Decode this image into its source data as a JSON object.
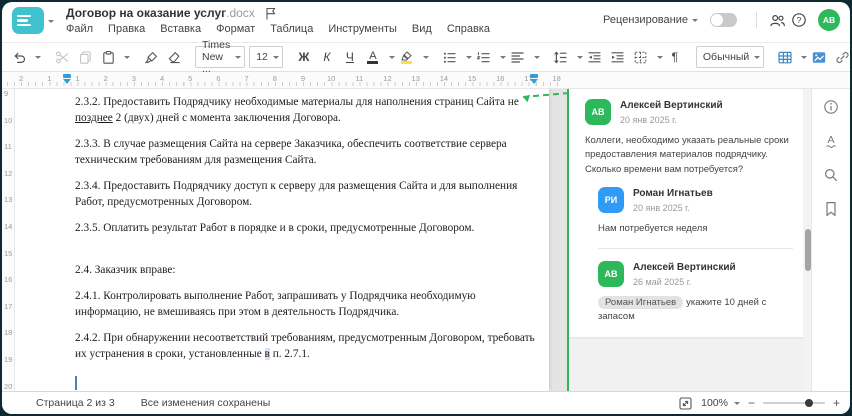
{
  "window": {
    "title": "Договор на оказание услуг",
    "title_ext": ".docx",
    "outer_bg": "#0d2a30",
    "logo_color": "#3fc2cd"
  },
  "menu": [
    "Файл",
    "Правка",
    "Вставка",
    "Формат",
    "Таблица",
    "Инструменты",
    "Вид",
    "Справка"
  ],
  "header": {
    "review_label": "Рецензирование",
    "review_toggle_on": false,
    "avatar_initials": "АВ",
    "avatar_color": "#2eb85c",
    "icons": [
      "dropdown-caret",
      "review-toggle",
      "collaboration-icon",
      "help-icon",
      "avatar"
    ]
  },
  "toolbar": {
    "font_name": "Times New ...",
    "font_size": "12",
    "bold_label": "Ж",
    "italic_label": "К",
    "underline_label": "Ч",
    "font_color_letter": "А",
    "highlight_color": "#fce143",
    "pilcrow": "¶",
    "style_name": "Обычный",
    "icons": [
      "undo-icon",
      "cut-icon",
      "copy-icon",
      "paste-icon",
      "format-painter-icon",
      "eraser-icon",
      "bullet-list-icon",
      "numbered-list-icon",
      "align-icon",
      "line-spacing-icon",
      "outdent-icon",
      "indent-icon",
      "borders-icon",
      "table-icon",
      "image-icon",
      "link-icon",
      "comment-icon",
      "more-icon"
    ],
    "accent_blue": "#3f88c5"
  },
  "ruler": {
    "h_numbers": [
      "2",
      "1",
      "1",
      "2",
      "3",
      "4",
      "5",
      "6",
      "7",
      "8",
      "9",
      "10",
      "11",
      "12",
      "13",
      "14",
      "15",
      "16",
      "17",
      "18"
    ],
    "v_numbers": [
      "9",
      "10",
      "11",
      "12",
      "13",
      "14",
      "15",
      "16",
      "17",
      "18",
      "19",
      "20"
    ],
    "marker_color": "#2f9fd8"
  },
  "document": {
    "p_232_pre": "2.3.2. Предоставить Подрядчику необходимые материалы для наполнения страниц Сайта не ",
    "p_232_underlined": "позднее",
    "p_232_post": " 2 (двух) дней с момента заключения Договора.",
    "p_233": "2.3.3. В случае размещения Сайта на сервере Заказчика, обеспечить соответствие сервера техническим требованиям для размещения Сайта.",
    "p_234": "2.3.4. Предоставить Подрядчику доступ к серверу для размещения Сайта и для выполнения Работ, предусмотренных Договором.",
    "p_235": "2.3.5. Оплатить результат Работ в порядке и в сроки, предусмотренные Договором.",
    "p_24": "2.4. Заказчик вправе:",
    "p_241": "2.4.1. Контролировать выполнение Работ, запрашивать у Подрядчика необходимую информацию, не вмешиваясь при этом в деятельность Подрядчика.",
    "p_242_pre": "2.4.2. При обнаружении несоответствий требованиям, предусмотренным Договором, требовать их устранения в сроки, установленные ",
    "p_242_highlighted": "в",
    "p_242_post": " п. 2.7.1."
  },
  "comments": {
    "accent": "#2eb85c",
    "thread": [
      {
        "initials": "АВ",
        "color": "#2eb85c",
        "name": "Алексей Вертинский",
        "date": "20 янв 2025 г.",
        "text": "Коллеги, необходимо указать реальные сроки предоставления материалов подрядчику. Сколько времени вам потребуется?"
      },
      {
        "initials": "РИ",
        "color": "#2f9bf4",
        "name": "Роман Игнатьев",
        "date": "20 янв 2025 г.",
        "text": "Нам потребуется неделя"
      },
      {
        "initials": "АВ",
        "color": "#2eb85c",
        "name": "Алексей Вертинский",
        "date": "26 май 2025 г.",
        "mention": "Роман Игнатьев",
        "text": "укажите 10 дней с запасом"
      }
    ]
  },
  "right_rail": {
    "icons": [
      "info-icon",
      "spellcheck-icon",
      "search-icon",
      "bookmark-icon"
    ]
  },
  "statusbar": {
    "page_label": "Страница 2 из 3",
    "saved_label": "Все изменения сохранены",
    "zoom_value": "100%"
  }
}
